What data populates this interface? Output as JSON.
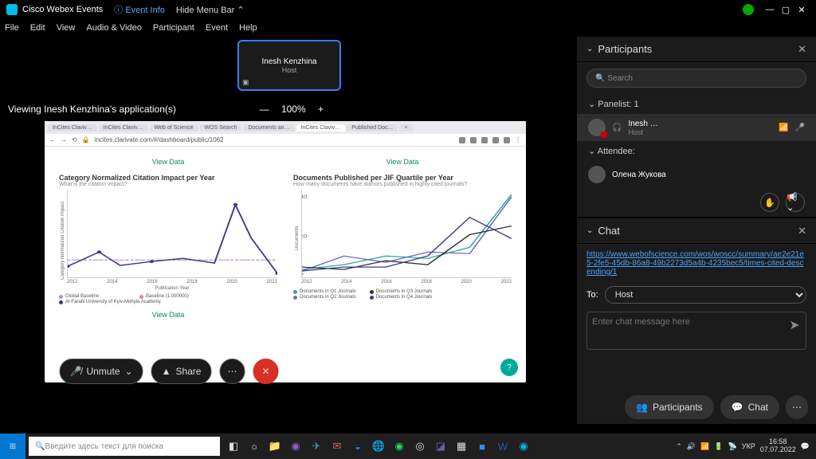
{
  "titlebar": {
    "app": "Cisco Webex Events",
    "info": "ⓘ Event Info",
    "hide": "Hide Menu Bar ⌃"
  },
  "menubar": [
    "File",
    "Edit",
    "View",
    "Audio & Video",
    "Participant",
    "Event",
    "Help"
  ],
  "thumb": {
    "name": "Inesh Kenzhina",
    "role": "Host"
  },
  "viewing": "Viewing Inesh Kenzhina's application(s)",
  "zoom": {
    "minus": "—",
    "val": "100%",
    "plus": "+"
  },
  "browser": {
    "tabs": [
      "InCites Claviv…",
      "InCites  Claviv…",
      "Web of Science",
      "WOS Search",
      "Documents an…",
      "InCites  Claviv…",
      "Published Doc…"
    ],
    "url": "incites.clarivate.com/#/dashboard/public/1062",
    "viewdata": "View Data",
    "left": {
      "title": "Category Normalized Citation Impact per Year",
      "sub": "What is the citation impact?",
      "xlabel": "Publication Year"
    },
    "right": {
      "title": "Documents Published per JIF Quartile per Year",
      "sub": "How many documents have authors published in highly cited journals?"
    },
    "legend_left": [
      "Global Baseline",
      "Al-Farabi University of Kyiv-Mohyla Academy",
      "Baseline (1.000000)"
    ],
    "legend_right": [
      "Documents in Q1 Journals",
      "Documents in Q2 Journals",
      "Documents in Q3 Journals",
      "Documents in Q4 Journals"
    ]
  },
  "participants": {
    "title": "Participants",
    "search_ph": "Search",
    "panelist": "Panelist: 1",
    "host": {
      "name": "Inesh …",
      "role": "Host"
    },
    "attendee": "Attendee:",
    "att_name": "Олена Жукова"
  },
  "chat": {
    "title": "Chat",
    "link": "https://www.webofscience.com/wos/woscc/summary/ae2e21e5-2fe5-45db-86a8-49b2273d5a4b-4235bec5/times-cited-descending/1",
    "to": "To:",
    "host": "Host",
    "placeholder": "Enter chat message here"
  },
  "dock": {
    "unmute": "Unmute",
    "share": "Share"
  },
  "botbtns": {
    "participants": "Participants",
    "chat": "Chat"
  },
  "taskbar": {
    "search": "Введите здесь текст для поиска",
    "lang": "УКР",
    "time": "16:58",
    "date": "07.07.2022"
  },
  "chart_data": [
    {
      "type": "line",
      "title": "Category Normalized Citation Impact per Year",
      "xlabel": "Publication Year",
      "ylabel": "Category Normalized Citation Impact",
      "x": [
        2012,
        2014,
        2016,
        2018,
        2020,
        2022
      ],
      "series": [
        {
          "name": "Global Baseline",
          "values": [
            1.0,
            1.0,
            1.0,
            1.0,
            1.0,
            1.0
          ],
          "color": "#b58ad6",
          "style": "dashed"
        },
        {
          "name": "Al-Farabi University of Kyiv-Mohyla Academy",
          "values": [
            0.6,
            1.1,
            0.6,
            0.8,
            4.2,
            0.2
          ],
          "color": "#3b3b8f"
        },
        {
          "name": "Baseline (1.000000)",
          "values": [
            1.0,
            1.0,
            1.0,
            1.0,
            1.0,
            1.0
          ],
          "color": "#d08bb0",
          "style": "dotted"
        }
      ],
      "ylim": [
        0,
        5
      ]
    },
    {
      "type": "line",
      "title": "Documents Published per JIF Quartile per Year",
      "xlabel": "Publication Year",
      "ylabel": "Documents",
      "x": [
        2012,
        2014,
        2016,
        2018,
        2020,
        2022
      ],
      "series": [
        {
          "name": "Documents in Q1 Journals",
          "values": [
            4,
            6,
            10,
            9,
            14,
            40
          ],
          "color": "#2fa89a"
        },
        {
          "name": "Documents in Q2 Journals",
          "values": [
            3,
            10,
            7,
            12,
            11,
            38
          ],
          "color": "#6a6ad1"
        },
        {
          "name": "Documents in Q3 Journals",
          "values": [
            5,
            4,
            8,
            6,
            20,
            24
          ],
          "color": "#333"
        },
        {
          "name": "Documents in Q4 Journals",
          "values": [
            3,
            5,
            5,
            10,
            28,
            18
          ],
          "color": "#3b3b8f"
        }
      ],
      "ylim": [
        0,
        40
      ]
    }
  ]
}
